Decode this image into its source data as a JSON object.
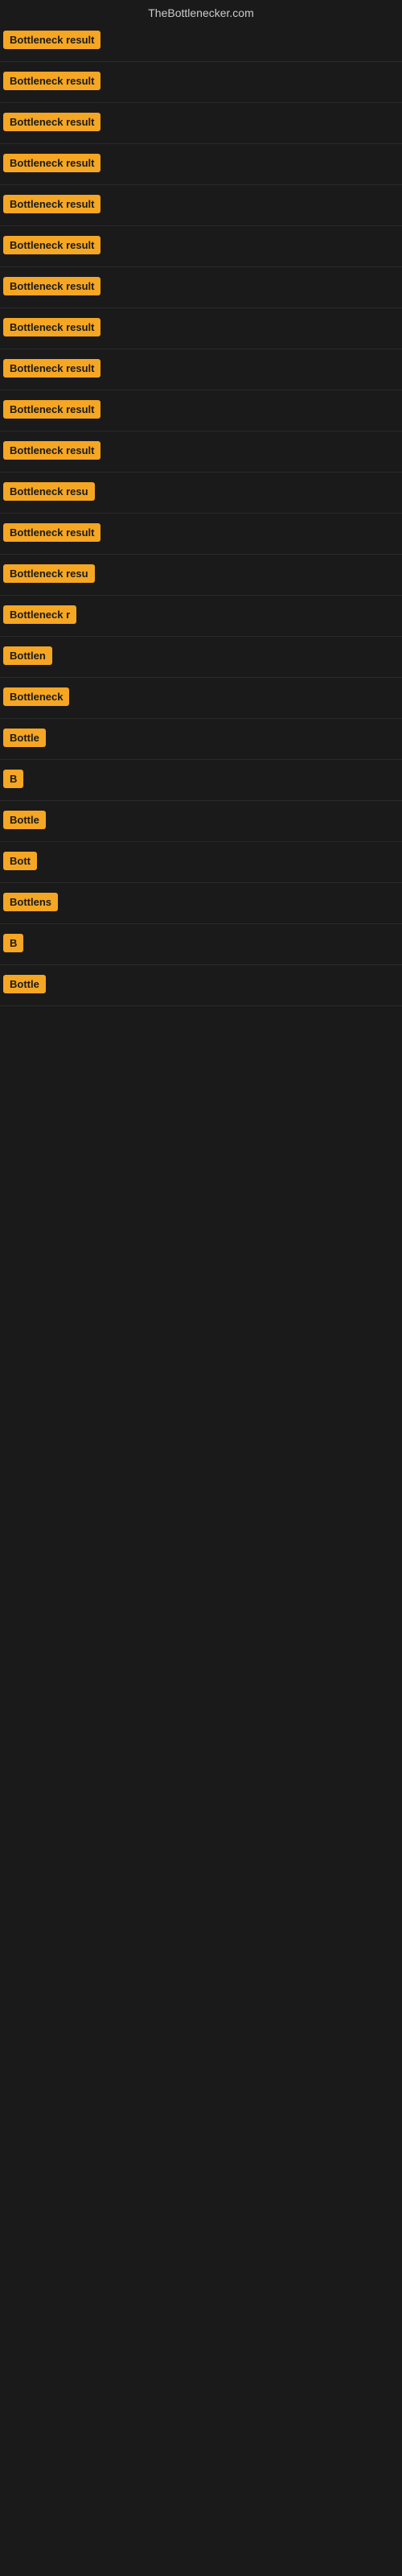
{
  "site": {
    "title": "TheBottlenecker.com"
  },
  "rows": [
    {
      "id": 1,
      "label": "Bottleneck result",
      "visible_text": "Bottleneck result"
    },
    {
      "id": 2,
      "label": "Bottleneck result",
      "visible_text": "Bottleneck result"
    },
    {
      "id": 3,
      "label": "Bottleneck result",
      "visible_text": "Bottleneck result"
    },
    {
      "id": 4,
      "label": "Bottleneck result",
      "visible_text": "Bottleneck result"
    },
    {
      "id": 5,
      "label": "Bottleneck result",
      "visible_text": "Bottleneck result"
    },
    {
      "id": 6,
      "label": "Bottleneck result",
      "visible_text": "Bottleneck result"
    },
    {
      "id": 7,
      "label": "Bottleneck result",
      "visible_text": "Bottleneck result"
    },
    {
      "id": 8,
      "label": "Bottleneck result",
      "visible_text": "Bottleneck result"
    },
    {
      "id": 9,
      "label": "Bottleneck result",
      "visible_text": "Bottleneck result"
    },
    {
      "id": 10,
      "label": "Bottleneck result",
      "visible_text": "Bottleneck result"
    },
    {
      "id": 11,
      "label": "Bottleneck result",
      "visible_text": "Bottleneck result"
    },
    {
      "id": 12,
      "label": "Bottleneck resu",
      "visible_text": "Bottleneck resu"
    },
    {
      "id": 13,
      "label": "Bottleneck result",
      "visible_text": "Bottleneck result"
    },
    {
      "id": 14,
      "label": "Bottleneck resu",
      "visible_text": "Bottleneck resu"
    },
    {
      "id": 15,
      "label": "Bottleneck r",
      "visible_text": "Bottleneck r"
    },
    {
      "id": 16,
      "label": "Bottlen",
      "visible_text": "Bottlen"
    },
    {
      "id": 17,
      "label": "Bottleneck",
      "visible_text": "Bottleneck"
    },
    {
      "id": 18,
      "label": "Bottle",
      "visible_text": "Bottle"
    },
    {
      "id": 19,
      "label": "B",
      "visible_text": "B"
    },
    {
      "id": 20,
      "label": "Bottle",
      "visible_text": "Bottle"
    },
    {
      "id": 21,
      "label": "Bott",
      "visible_text": "Bott"
    },
    {
      "id": 22,
      "label": "Bottlens",
      "visible_text": "Bottlens"
    },
    {
      "id": 23,
      "label": "B",
      "visible_text": "B"
    },
    {
      "id": 24,
      "label": "Bottle",
      "visible_text": "Bottle"
    }
  ]
}
